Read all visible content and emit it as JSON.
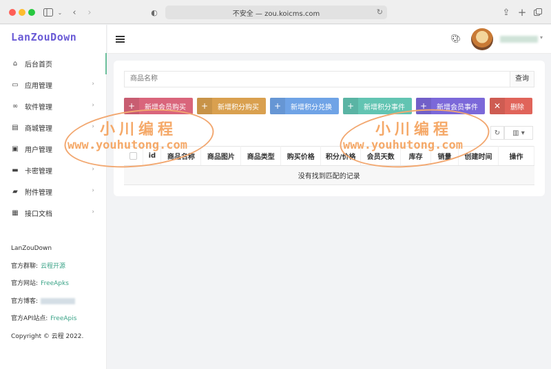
{
  "browser": {
    "url": "不安全 — zou.koicms.com"
  },
  "sidebar": {
    "logo": "LanZouDown",
    "items": [
      {
        "label": "后台首页",
        "icon": "home-icon"
      },
      {
        "label": "应用管理",
        "icon": "laptop-icon"
      },
      {
        "label": "软件管理",
        "icon": "software-icon"
      },
      {
        "label": "商城管理",
        "icon": "store-icon"
      },
      {
        "label": "用户管理",
        "icon": "user-card-icon"
      },
      {
        "label": "卡密管理",
        "icon": "credit-card-icon"
      },
      {
        "label": "附件管理",
        "icon": "folder-icon"
      },
      {
        "label": "接口文档",
        "icon": "archive-icon"
      }
    ],
    "info": {
      "name": "LanZouDown",
      "group_label": "官方群聊:",
      "group_link": "云程开源",
      "site_label": "官方网站:",
      "site_link": "FreeApks",
      "blog_label": "官方博客:",
      "api_label": "官方API站点:",
      "api_link": "FreeApis",
      "copyright": "Copyright © 云程 2022."
    }
  },
  "main": {
    "search_placeholder": "商品名称",
    "search_button": "查询",
    "actions": [
      {
        "label": "新增会员购买",
        "color": "#d9657b"
      },
      {
        "label": "新增积分购买",
        "color": "#d9a04f"
      },
      {
        "label": "新增积分兑换",
        "color": "#6fa3e6"
      },
      {
        "label": "新增积分事件",
        "color": "#62c4b2"
      },
      {
        "label": "新增会员事件",
        "color": "#7b68d9"
      },
      {
        "label": "删除",
        "color": "#e0645a"
      }
    ],
    "columns": [
      "id",
      "商品名称",
      "商品图片",
      "商品类型",
      "购买价格",
      "积分/价格",
      "会员天数",
      "库存",
      "销量",
      "创建时间",
      "操作"
    ],
    "empty_text": "没有找到匹配的记录"
  },
  "watermark": {
    "title": "小川编程",
    "url": "www.youhutong.com"
  },
  "colors": {
    "accent": "#3aa387",
    "logo": "#6a5bd6",
    "watermark": "#f5a969"
  }
}
